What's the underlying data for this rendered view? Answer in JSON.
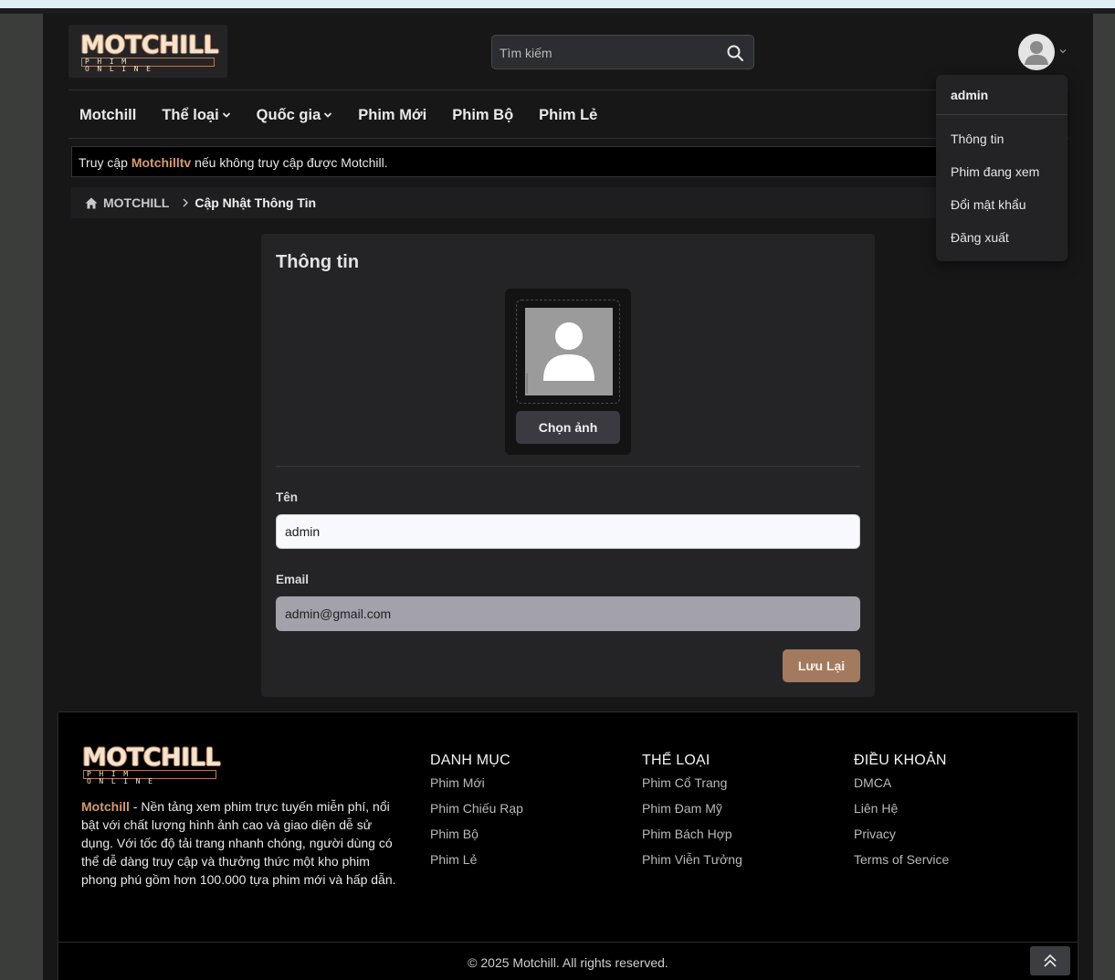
{
  "header": {
    "logo_text": "MOTCHILL",
    "logo_sub": "PHIM ONLINE",
    "search_placeholder": "Tìm kiếm"
  },
  "nav": {
    "items": [
      {
        "label": "Motchill",
        "dropdown": false
      },
      {
        "label": "Thể loại",
        "dropdown": true
      },
      {
        "label": "Quốc gia",
        "dropdown": true
      },
      {
        "label": "Phim Mới",
        "dropdown": false
      },
      {
        "label": "Phim Bộ",
        "dropdown": false
      },
      {
        "label": "Phim Lẻ",
        "dropdown": false
      }
    ]
  },
  "notice": {
    "prefix": "Truy cập ",
    "brand": "Motchilltv",
    "suffix": " nếu không truy cập được Motchill."
  },
  "breadcrumb": {
    "home": "MOTCHILL",
    "current": "Cập Nhật Thông Tin"
  },
  "profile": {
    "title": "Thông tin",
    "choose_photo": "Chọn ảnh",
    "name_label": "Tên",
    "name_value": "admin",
    "email_label": "Email",
    "email_value": "admin@gmail.com",
    "save_label": "Lưu Lại"
  },
  "user_menu": {
    "username": "admin",
    "items": [
      "Thông tin",
      "Phim đang xem",
      "Đổi mật khẩu",
      "Đăng xuất"
    ]
  },
  "footer": {
    "logo_text": "MOTCHILL",
    "logo_sub": "PHIM ONLINE",
    "desc_brand": "Motchill",
    "desc_text": " - Nền tảng xem phim trực tuyến miễn phí, nổi bật với chất lượng hình ảnh cao và giao diện dễ sử dụng. Với tốc độ tải trang nhanh chóng, người dùng có thể dễ dàng truy cập và thưởng thức một kho phim phong phú gồm hơn 100.000 tựa phim mới và hấp dẫn.",
    "columns": [
      {
        "title": "DANH MỤC",
        "links": [
          "Phim Mới",
          "Phim Chiếu Rạp",
          "Phim Bộ",
          "Phim Lẻ"
        ]
      },
      {
        "title": "THỂ LOẠI",
        "links": [
          "Phim Cổ Trang",
          "Phim Đam Mỹ",
          "Phim Bách Hợp",
          "Phim Viễn Tưởng"
        ]
      },
      {
        "title": "ĐIỀU KHOẢN",
        "links": [
          "DMCA",
          "Liên Hệ",
          "Privacy",
          "Terms of Service"
        ]
      }
    ],
    "copyright": "© 2025 Motchill. All rights reserved."
  },
  "colors": {
    "accent": "#d39b70",
    "save_button": "#a47a5e",
    "page_bg": "#171718"
  }
}
